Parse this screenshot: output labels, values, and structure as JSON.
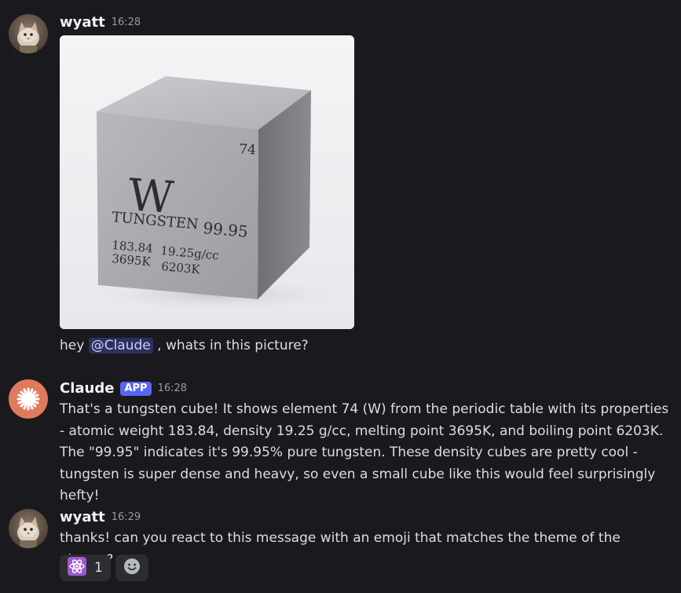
{
  "messages": [
    {
      "username": "wyatt",
      "time": "16:28",
      "text_before": "hey ",
      "mention": "@Claude",
      "text_after": " , whats in this picture?",
      "attachment": {
        "icon": "tungsten-cube-image",
        "atomic_number": "74",
        "symbol": "W",
        "name": "TUNGSTEN",
        "purity": "99.95",
        "atomic_weight": "183.84",
        "density": "19.25g/cc",
        "melting_point": "3695K",
        "boiling_point": "6203K"
      }
    },
    {
      "username": "Claude",
      "badge": "APP",
      "time": "16:28",
      "text": "That's a tungsten cube! It shows element 74 (W) from the periodic table with its properties - atomic weight 183.84, density 19.25 g/cc, melting point 3695K, and boiling point 6203K. The \"99.95\" indicates it's 99.95% pure tungsten. These density cubes are pretty cool - tungsten is super dense and heavy, so even a small cube like this would feel surprisingly hefty!"
    },
    {
      "username": "wyatt",
      "time": "16:29",
      "text": "thanks! can you react to this message with an emoji that matches the theme of the picture?",
      "reactions": [
        {
          "emoji": "atom-symbol-icon",
          "count": "1"
        }
      ],
      "add_reaction_icon": "smiley-face-icon"
    }
  ],
  "colors": {
    "background": "#1a1a1e",
    "username": "#f2f3f5",
    "text": "#dbdee1",
    "timestamp": "#949ba4",
    "app_badge": "#5865f2",
    "claude_avatar": "#e07a5f",
    "reaction_bg": "#2b2d31",
    "atom_emoji": "#9b59d0"
  }
}
